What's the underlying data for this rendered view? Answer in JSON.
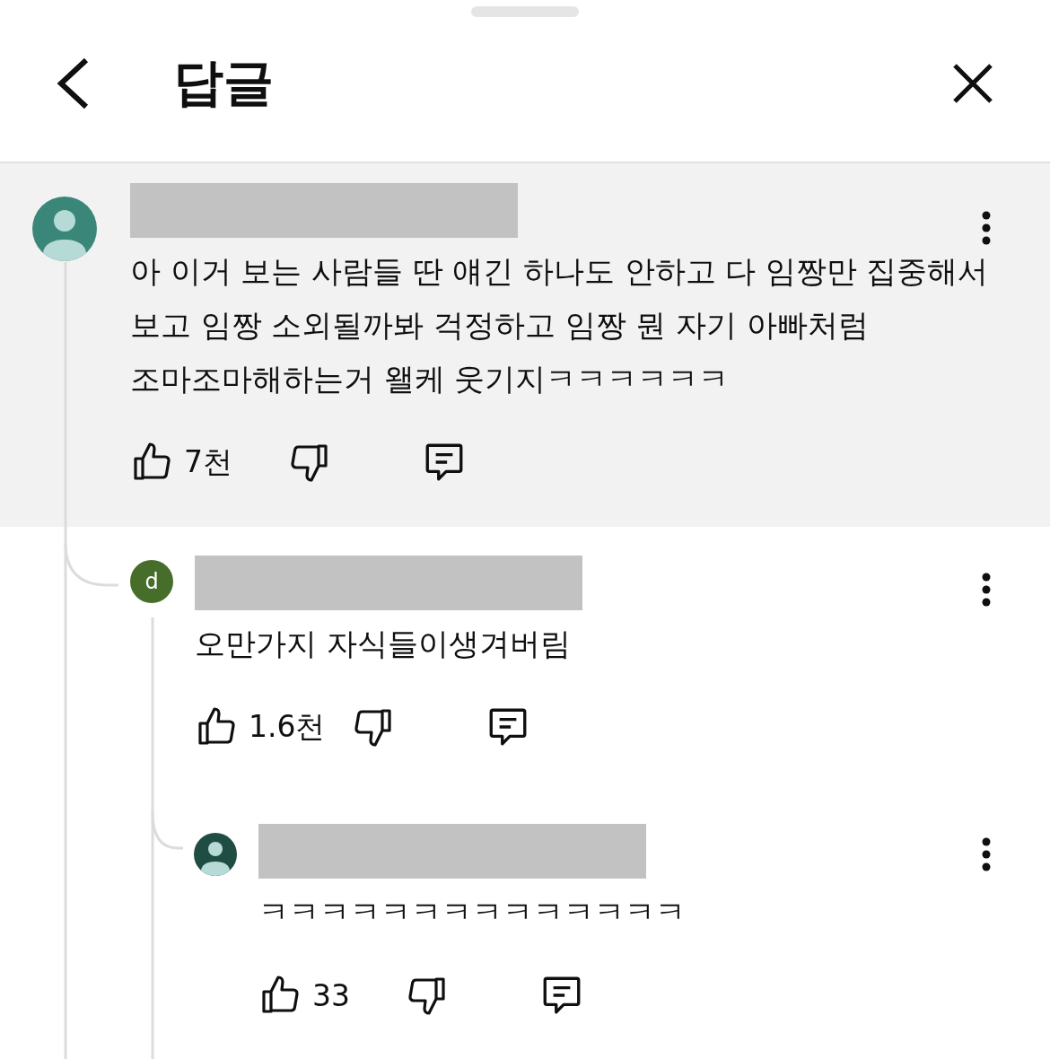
{
  "sheet": {
    "title": "답글"
  },
  "comment": {
    "avatar": {
      "kind": "silhouette",
      "color": "#3a877a"
    },
    "highlighted": true,
    "text": "아 이거 보는 사람들 딴 얘긴 하나도 안하고 다 임짱만 집중해서 보고 임짱 소외될까봐 걱정하고 임짱 뭔 자기 아빠처럼 조마조마해하는거 왤케 웃기지ㅋㅋㅋㅋㅋㅋ",
    "likes": "7천",
    "children": [
      {
        "avatar": {
          "kind": "letter",
          "letter": "d",
          "color": "#466d2a"
        },
        "highlighted": false,
        "text": "오만가지 자식들이생겨버림",
        "likes": "1.6천",
        "children": [
          {
            "avatar": {
              "kind": "silhouette",
              "color": "#1f4d43"
            },
            "highlighted": false,
            "text": "ㅋㅋㅋㅋㅋㅋㅋㅋㅋㅋㅋㅋㅋㅋ",
            "likes": "33"
          }
        ]
      }
    ]
  }
}
